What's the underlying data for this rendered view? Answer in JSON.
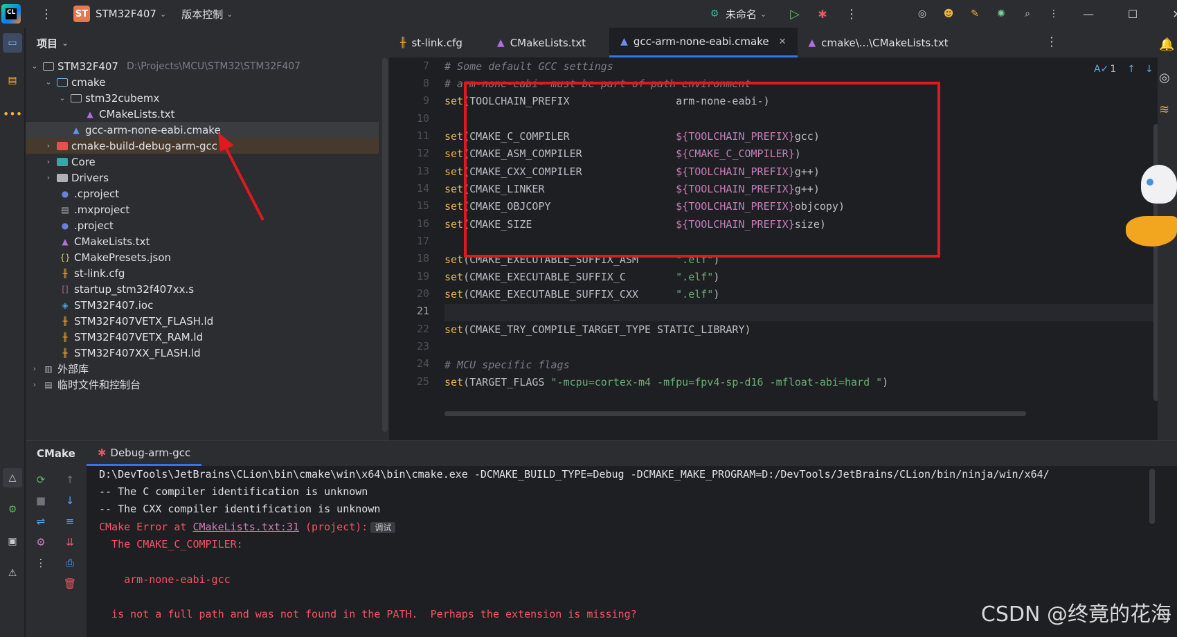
{
  "titlebar": {
    "project_badge": "ST",
    "project_name": "STM32F407",
    "vcs_menu": "版本控制",
    "run_config": "未命名"
  },
  "project_panel": {
    "title": "项目",
    "items": [
      {
        "label": "STM32F407",
        "path": "D:\\Projects\\MCU\\STM32\\STM32F407"
      },
      {
        "label": "cmake"
      },
      {
        "label": "stm32cubemx"
      },
      {
        "label": "CMakeLists.txt"
      },
      {
        "label": "gcc-arm-none-eabi.cmake"
      },
      {
        "label": "cmake-build-debug-arm-gcc"
      },
      {
        "label": "Core"
      },
      {
        "label": "Drivers"
      },
      {
        "label": ".cproject"
      },
      {
        "label": ".mxproject"
      },
      {
        "label": ".project"
      },
      {
        "label": "CMakeLists.txt"
      },
      {
        "label": "CMakePresets.json"
      },
      {
        "label": "st-link.cfg"
      },
      {
        "label": "startup_stm32f407xx.s"
      },
      {
        "label": "STM32F407.ioc"
      },
      {
        "label": "STM32F407VETX_FLASH.ld"
      },
      {
        "label": "STM32F407VETX_RAM.ld"
      },
      {
        "label": "STM32F407XX_FLASH.ld"
      },
      {
        "label": "外部库"
      },
      {
        "label": "临时文件和控制台"
      }
    ]
  },
  "editor": {
    "tabs": [
      {
        "label": "st-link.cfg"
      },
      {
        "label": "CMakeLists.txt"
      },
      {
        "label": "gcc-arm-none-eabi.cmake"
      },
      {
        "label": "cmake\\...\\CMakeLists.txt"
      }
    ],
    "inspection_count": "1",
    "lines": [
      {
        "n": "7",
        "comment": "# Some default GCC settings"
      },
      {
        "n": "8",
        "comment": "# arm-none-eabi- must be part of path environment"
      },
      {
        "n": "9",
        "arg": "TOOLCHAIN_PREFIX",
        "pad": "                 ",
        "value": "arm-none-eabi-)"
      },
      {
        "n": "10"
      },
      {
        "n": "11",
        "arg": "CMAKE_C_COMPILER",
        "pad": "                 ",
        "var": "${TOOLCHAIN_PREFIX}",
        "value": "gcc)"
      },
      {
        "n": "12",
        "arg": "CMAKE_ASM_COMPILER",
        "pad": "               ",
        "var": "${CMAKE_C_COMPILER}",
        "value": ")"
      },
      {
        "n": "13",
        "arg": "CMAKE_CXX_COMPILER",
        "pad": "               ",
        "var": "${TOOLCHAIN_PREFIX}",
        "value": "g++)"
      },
      {
        "n": "14",
        "arg": "CMAKE_LINKER",
        "pad": "                     ",
        "var": "${TOOLCHAIN_PREFIX}",
        "value": "g++)"
      },
      {
        "n": "15",
        "arg": "CMAKE_OBJCOPY",
        "pad": "                    ",
        "var": "${TOOLCHAIN_PREFIX}",
        "value": "objcopy)"
      },
      {
        "n": "16",
        "arg": "CMAKE_SIZE",
        "pad": "                       ",
        "var": "${TOOLCHAIN_PREFIX}",
        "value": "size)"
      },
      {
        "n": "17"
      },
      {
        "n": "18",
        "arg": "CMAKE_EXECUTABLE_SUFFIX_ASM",
        "pad": "      ",
        "str": "\".elf\"",
        "value": ")"
      },
      {
        "n": "19",
        "arg": "CMAKE_EXECUTABLE_SUFFIX_C",
        "pad": "        ",
        "str": "\".elf\"",
        "value": ")"
      },
      {
        "n": "20",
        "arg": "CMAKE_EXECUTABLE_SUFFIX_CXX",
        "pad": "      ",
        "str": "\".elf\"",
        "value": ")"
      },
      {
        "n": "21"
      },
      {
        "n": "22",
        "arg": "CMAKE_TRY_COMPILE_TARGET_TYPE STATIC_LIBRARY)"
      },
      {
        "n": "23"
      },
      {
        "n": "24",
        "comment": "# MCU specific flags"
      },
      {
        "n": "25",
        "arg": "TARGET_FLAGS ",
        "str": "\"-mcpu=cortex-m4 -mfpu=fpv4-sp-d16 -mfloat-abi=hard \"",
        "value": ")"
      }
    ],
    "keyword": "set"
  },
  "bottom": {
    "tabs": [
      {
        "label": "CMake"
      },
      {
        "label": "Debug-arm-gcc"
      }
    ],
    "console": [
      {
        "text": "D:\\DevTools\\JetBrains\\CLion\\bin\\cmake\\win\\x64\\bin\\cmake.exe -DCMAKE_BUILD_TYPE=Debug -DCMAKE_MAKE_PROGRAM=D:/DevTools/JetBrains/CLion/bin/ninja/win/x64/"
      },
      {
        "text": "-- The C compiler identification is unknown"
      },
      {
        "text": "-- The CXX compiler identification is unknown"
      },
      {
        "err_prefix": "CMake Error at ",
        "link": "CMakeLists.txt:31",
        "err_suffix": " (project):",
        "chip": "调试"
      },
      {
        "err": "  The CMAKE_C_COMPILER:"
      },
      {
        "err": ""
      },
      {
        "err": "    arm-none-eabi-gcc"
      },
      {
        "err": ""
      },
      {
        "err": "  is not a full path and was not found in the PATH.  Perhaps the extension is missing?"
      }
    ]
  },
  "watermark": "CSDN @终竟的花海",
  "colors": {
    "accent": "#3574f0",
    "annotation_red": "#e0191f",
    "error": "#f75464"
  }
}
